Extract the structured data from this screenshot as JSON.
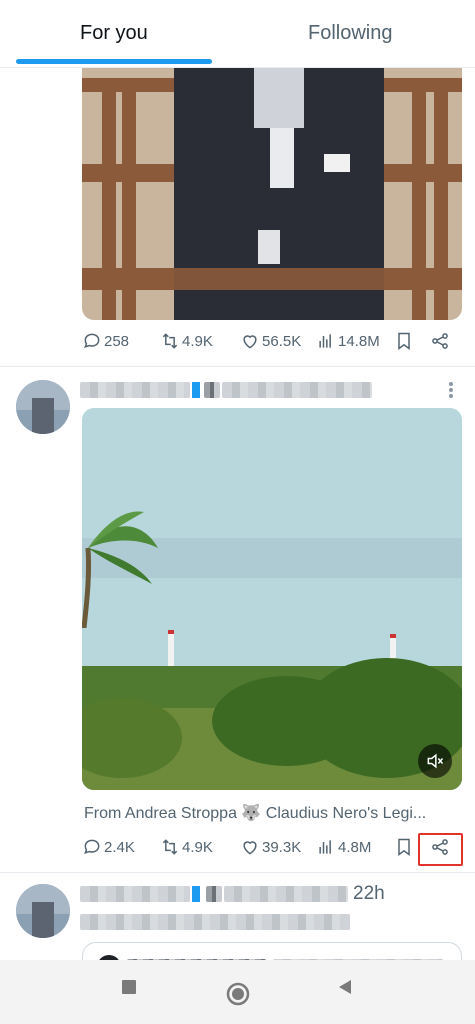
{
  "tabs": [
    {
      "label": "For you",
      "active": true
    },
    {
      "label": "Following",
      "active": false
    }
  ],
  "accent_color": "#1d9bf0",
  "post1": {
    "stats": {
      "replies": "258",
      "reposts": "4.9K",
      "likes": "56.5K",
      "views": "14.8M"
    }
  },
  "post2": {
    "source": "From Andrea Stroppa 🐺 Claudius Nero's Legi...",
    "stats": {
      "replies": "2.4K",
      "reposts": "4.9K",
      "likes": "39.3K",
      "views": "4.8M"
    },
    "highlighted_action": "share-icon",
    "highlight_color": "#e0332c"
  },
  "post3": {
    "time": "22h"
  },
  "icons": [
    "reply-icon",
    "repost-icon",
    "like-icon",
    "views-icon",
    "bookmark-icon",
    "share-icon",
    "more-icon",
    "mute-icon",
    "nav-recents-icon",
    "nav-home-icon",
    "nav-back-icon"
  ]
}
